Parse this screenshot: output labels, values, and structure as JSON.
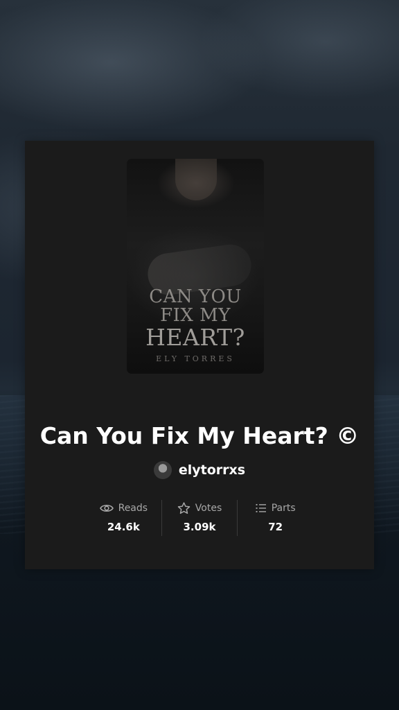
{
  "story": {
    "title": "Can You Fix My Heart? ©",
    "author": "elytorrxs"
  },
  "cover": {
    "title_line1": "CAN YOU",
    "title_line2": "FIX MY",
    "title_line3": "HEART?",
    "author": "ELY TORRES"
  },
  "stats": [
    {
      "label": "Reads",
      "value": "24.6k",
      "icon": "eye-icon"
    },
    {
      "label": "Votes",
      "value": "3.09k",
      "icon": "star-icon"
    },
    {
      "label": "Parts",
      "value": "72",
      "icon": "list-icon"
    }
  ]
}
